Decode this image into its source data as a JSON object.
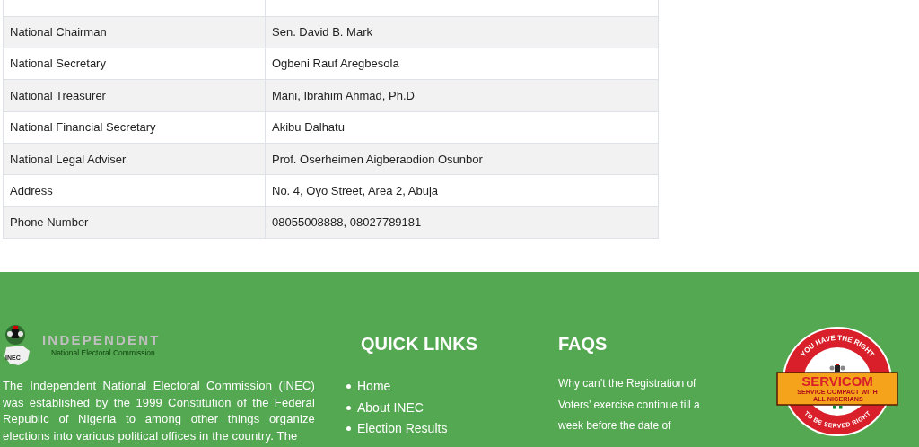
{
  "table": {
    "rows": [
      {
        "label": "National Chairman",
        "value": "Sen. David B. Mark"
      },
      {
        "label": "National Secretary",
        "value": "Ogbeni Rauf Aregbesola"
      },
      {
        "label": "National Treasurer",
        "value": "Mani, Ibrahim Ahmad, Ph.D"
      },
      {
        "label": "National Financial Secretary",
        "value": "Akibu Dalhatu"
      },
      {
        "label": "National Legal Adviser",
        "value": "Prof. Oserheimen Aigberaodion Osunbor"
      },
      {
        "label": "Address",
        "value": "No. 4, Oyo Street, Area 2, Abuja"
      },
      {
        "label": "Phone Number",
        "value": "08055008888, 08027789181"
      }
    ]
  },
  "footer": {
    "logo": {
      "badge": "INEC",
      "title": "INDEPENDENT",
      "subtitle": "National Electoral Commission"
    },
    "about": "The Independent National Electoral Commission (INEC) was established by the 1999 Constitution of the Federal Republic of Nigeria to among other things organize elections into various political offices in the country. The",
    "quick_links": {
      "title": "QUICK LINKS",
      "items": [
        "Home",
        "About INEC",
        "Election Results"
      ]
    },
    "faqs": {
      "title": "FAQS",
      "items": [
        "Why can’t the Registration of Voters’ exercise continue till a week before the date of"
      ]
    },
    "seal": {
      "top_text": "YOU HAVE THE RIGHT",
      "title": "SERVICOM",
      "tagline": "SERVICE COMPACT WITH ALL NIGERIANS",
      "bottom_text": "TO BE SERVED RIGHT"
    }
  }
}
